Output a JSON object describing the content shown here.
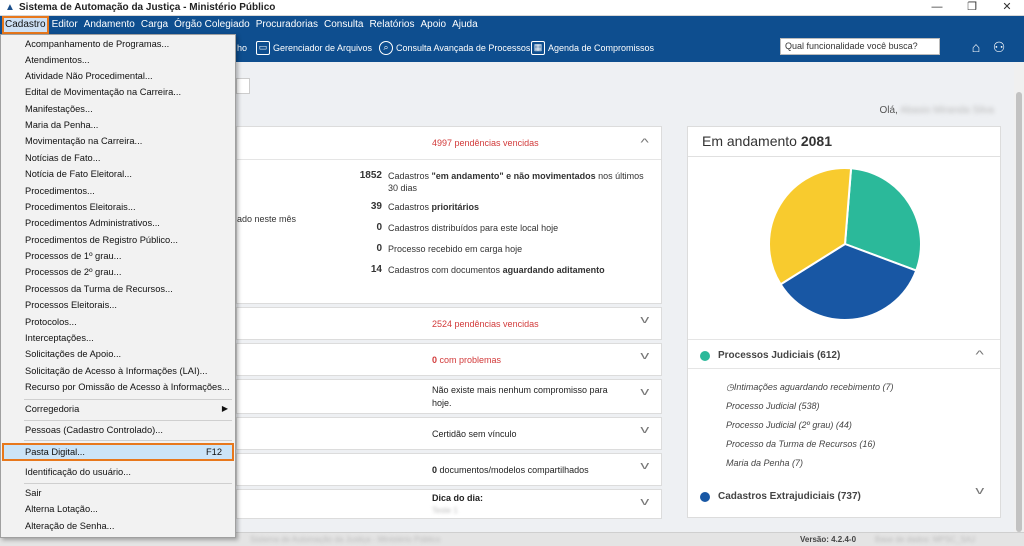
{
  "window": {
    "title": "Sistema de Automação da Justiça - Ministério Público",
    "controls": [
      "—",
      "❐",
      "✕"
    ]
  },
  "menubar": [
    "Cadastro",
    "Editor",
    "Andamento",
    "Carga",
    "Órgão Colegiado",
    "Procuradorias",
    "Consulta",
    "Relatórios",
    "Apoio",
    "Ajuda"
  ],
  "toolbar": {
    "partial_label": "ho",
    "file_manager": "Gerenciador de Arquivos",
    "advanced_search": "Consulta Avançada de Processos",
    "schedule": "Agenda de Compromissos",
    "search_placeholder": "Qual funcionalidade você busca?"
  },
  "greeting": "Olá,",
  "greeting_name": "Abasio Miranda Silva",
  "cadastro_menu": [
    "Acompanhamento de Programas...",
    "Atendimentos...",
    "Atividade Não Procedimental...",
    "Edital de Movimentação na Carreira...",
    "Manifestações...",
    "Maria da Penha...",
    "Movimentação na Carreira...",
    "Notícias de Fato...",
    "Notícia de Fato Eleitoral...",
    "Procedimentos...",
    "Procedimentos Eleitorais...",
    "Procedimentos Administrativos...",
    "Procedimentos de Registro Público...",
    "Processos de 1º grau...",
    "Processos de 2º grau...",
    "Processos da Turma de Recursos...",
    "Processos Eleitorais...",
    "Protocolos...",
    "Interceptações...",
    "Solicitações de Apoio...",
    "Solicitação de Acesso à Informações (LAI)...",
    "Recurso por Omissão de Acesso à Informações..."
  ],
  "cadastro_menu_2": {
    "corregedoria": "Corregedoria",
    "pessoas": "Pessoas (Cadastro Controlado)...",
    "pasta_digital": "Pasta Digital...",
    "pasta_shortcut": "F12",
    "identificacao": "Identificação do usuário...",
    "sair": "Sair",
    "alterna": "Alterna Lotação...",
    "alteracao": "Alteração de Senha..."
  },
  "panels": {
    "p1_header": "4997 pendências vencidas",
    "p1_left_fragment": "ado neste mês",
    "stats": [
      {
        "num": "1852",
        "pre": "Cadastros ",
        "bold": "\"em andamento\" e não movimentados",
        "post": " nos últimos 30 dias"
      },
      {
        "num": "39",
        "pre": "Cadastros ",
        "bold": "prioritários",
        "post": ""
      },
      {
        "num": "0",
        "pre": "Cadastros distribuídos para este local hoje",
        "bold": "",
        "post": ""
      },
      {
        "num": "0",
        "pre": "Processo recebido em carga hoje",
        "bold": "",
        "post": ""
      },
      {
        "num": "14",
        "pre": "Cadastros com documentos ",
        "bold": "aguardando aditamento",
        "post": ""
      }
    ],
    "p2": "2524 pendências vencidas",
    "p3_num": "0",
    "p3_txt": " com problemas",
    "p4": "Não existe mais nenhum compromisso para hoje.",
    "p5": "Certidão sem vínculo",
    "p6_num": "0",
    "p6_txt": " documentos/modelos compartilhados",
    "p7": "Dica do dia:",
    "p7_sub": "Teste 1"
  },
  "right": {
    "title": "Em andamento",
    "total": "2081",
    "groups": [
      {
        "label": "Processos Judiciais",
        "count": "(612)",
        "color": "#2bb99a"
      },
      {
        "label": "Cadastros Extrajudiciais",
        "count": "(737)",
        "color": "#1857a4"
      }
    ],
    "items": [
      "Intimações aguardando recebimento (7)",
      "Processo Judicial (538)",
      "Processo Judicial (2º grau) (44)",
      "Processo da Turma de Recursos (16)",
      "Maria da Penha (7)"
    ]
  },
  "chart_data": {
    "type": "pie",
    "categories": [
      "Processos Judiciais",
      "Cadastros Extrajudiciais",
      ""
    ],
    "values": [
      612,
      737,
      732
    ],
    "colors": [
      "#2bb99a",
      "#1857a4",
      "#f8cb2e"
    ]
  },
  "status": {
    "left": "Sistema de Automação da Justiça - Ministério Público",
    "version": "Versão: 4.2.4-0",
    "right": "Base de dados: MPSC_SAJ"
  }
}
